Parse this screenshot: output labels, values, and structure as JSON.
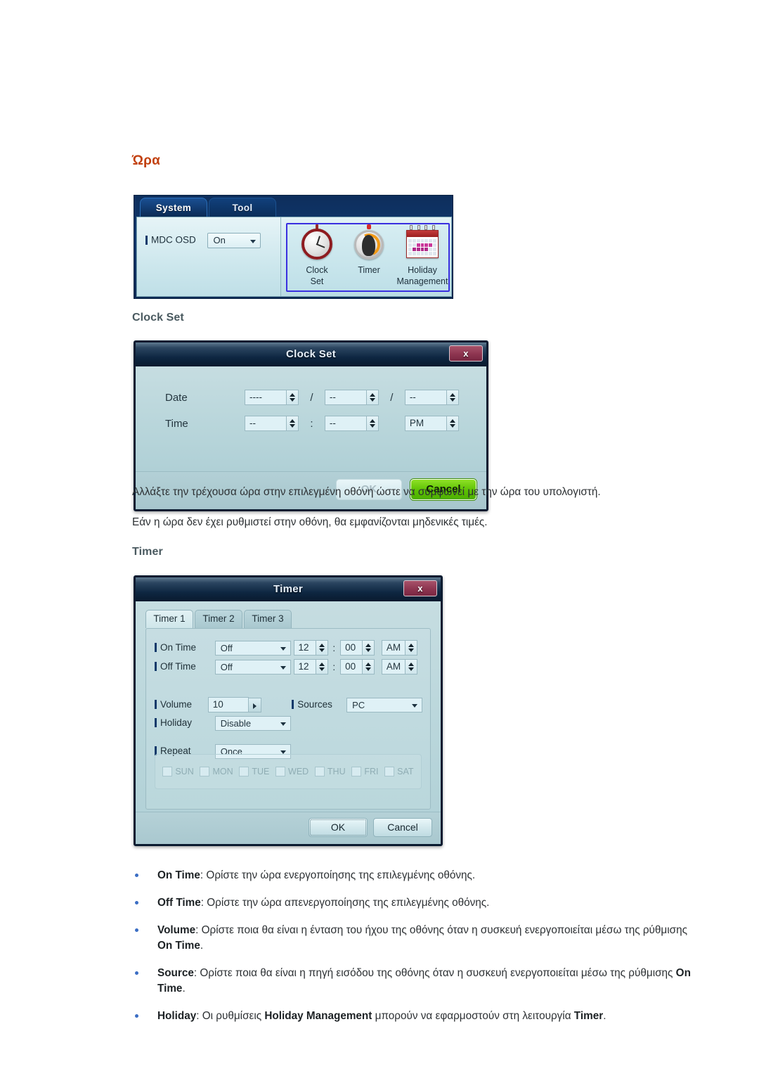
{
  "document": {
    "section_heading": "Ώρα",
    "sub_headings": {
      "clock_set": "Clock Set",
      "timer": "Timer"
    },
    "paragraphs": {
      "p1": "Αλλάξτε την τρέχουσα ώρα στην επιλεγμένη οθόνη ώστε να συμφωνεί με την ώρα του υπολογιστή.",
      "p2": "Εάν η ώρα δεν έχει ρυθμιστεί στην οθόνη, θα εμφανίζονται μηδενικές τιμές."
    },
    "bullets": [
      {
        "term": "On Time",
        "text": ": Ορίστε την ώρα ενεργοποίησης της επιλεγμένης οθόνης."
      },
      {
        "term": "Off Time",
        "text": ": Ορίστε την ώρα απενεργοποίησης της επιλεγμένης οθόνης."
      },
      {
        "term": "Volume",
        "text_a": ": Ορίστε ποια θα είναι η ένταση του ήχου της οθόνης όταν η συσκευή ενεργοποιείται μέσω της ρύθμισης ",
        "term_b": "On Time",
        "text_b": "."
      },
      {
        "term": "Source",
        "text_a": ": Ορίστε ποια θα είναι η πηγή εισόδου της οθόνης όταν η συσκευή ενεργοποιείται μέσω της ρύθμισης ",
        "term_b": "On Time",
        "text_b": "."
      },
      {
        "term": "Holiday",
        "text_a": ": Οι ρυθμίσεις ",
        "term_b": "Holiday Management",
        "text_b": " μπορούν να εφαρμοστούν στη λειτουργία ",
        "term_c": "Timer",
        "text_c": "."
      }
    ]
  },
  "mdc_panel": {
    "tabs": [
      {
        "label": "System",
        "active": true
      },
      {
        "label": "Tool",
        "active": false
      }
    ],
    "mdc_osd": {
      "label": "MDC OSD",
      "value": "On"
    },
    "tool_icons": [
      {
        "name": "clock-set-icon",
        "line1": "Clock",
        "line2": "Set"
      },
      {
        "name": "timer-icon",
        "line1": "Timer",
        "line2": ""
      },
      {
        "name": "holiday-management-icon",
        "line1": "Holiday",
        "line2": "Management"
      }
    ]
  },
  "clock_set_dialog": {
    "title": "Clock Set",
    "close_label": "x",
    "date_label": "Date",
    "time_label": "Time",
    "date": {
      "year": "----",
      "month": "--",
      "day": "--"
    },
    "time": {
      "hour": "--",
      "minute": "--",
      "meridiem": "PM"
    },
    "separators": {
      "date": "/",
      "time": ":"
    },
    "buttons": {
      "ok": "OK",
      "cancel": "Cancel"
    }
  },
  "timer_dialog": {
    "title": "Timer",
    "close_label": "x",
    "tabs": [
      {
        "label": "Timer 1",
        "active": true
      },
      {
        "label": "Timer 2",
        "active": false
      },
      {
        "label": "Timer 3",
        "active": false
      }
    ],
    "rows": {
      "on_time": {
        "label": "On Time",
        "mode": "Off",
        "hour": "12",
        "minute": "00",
        "meridiem": "AM"
      },
      "off_time": {
        "label": "Off Time",
        "mode": "Off",
        "hour": "12",
        "minute": "00",
        "meridiem": "AM"
      },
      "volume": {
        "label": "Volume",
        "value": "10"
      },
      "sources": {
        "label": "Sources",
        "value": "PC"
      },
      "holiday": {
        "label": "Holiday",
        "value": "Disable"
      },
      "repeat": {
        "label": "Repeat",
        "value": "Once"
      }
    },
    "colon": ":",
    "days": [
      "SUN",
      "MON",
      "TUE",
      "WED",
      "THU",
      "FRI",
      "SAT"
    ],
    "buttons": {
      "ok": "OK",
      "cancel": "Cancel"
    }
  },
  "colors": {
    "heading": "#c2400e",
    "subheading": "#4a5a60",
    "bullet": "#3b6ec4",
    "dialog_title_bar": "#0e2742",
    "dialog_body": "#bad7dc",
    "close_button": "#8d3550",
    "cancel_green": "#5cc103",
    "selection_outline": "#3a2fe0"
  }
}
